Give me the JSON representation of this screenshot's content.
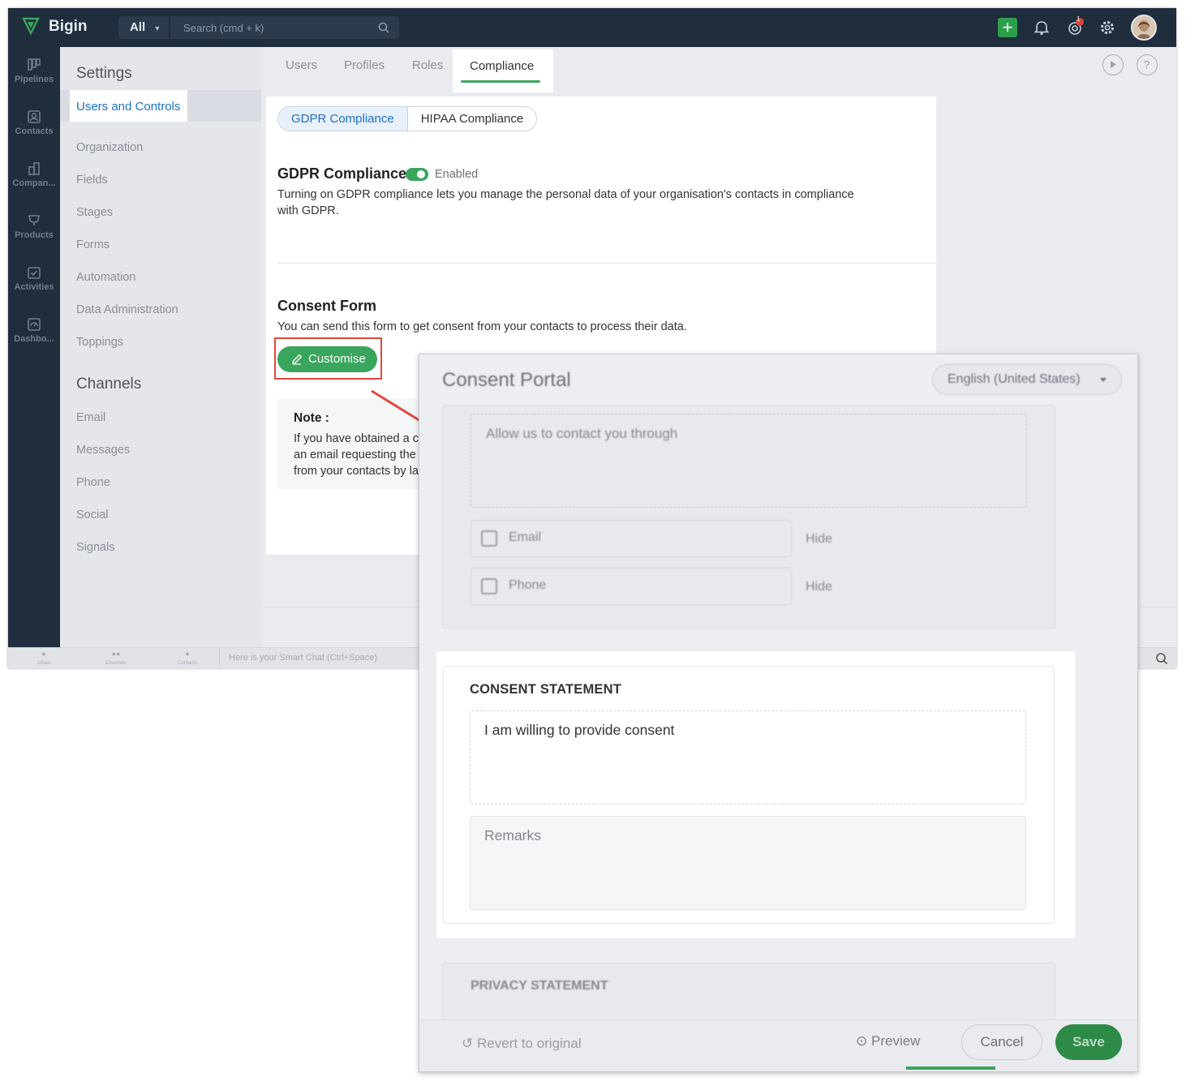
{
  "topbar": {
    "brand": "Bigin",
    "all_label": "All",
    "search_placeholder": "Search (cmd + k)",
    "notification_count": "1"
  },
  "rail": {
    "items": [
      {
        "label": "Pipelines",
        "icon": "pipelines-icon"
      },
      {
        "label": "Contacts",
        "icon": "contacts-icon"
      },
      {
        "label": "Compan...",
        "icon": "companies-icon"
      },
      {
        "label": "Products",
        "icon": "products-icon"
      },
      {
        "label": "Activities",
        "icon": "activities-icon"
      },
      {
        "label": "Dashbo...",
        "icon": "dashboards-icon"
      }
    ]
  },
  "sidebar": {
    "title": "Settings",
    "items": [
      "Users and Controls",
      "Organization",
      "Fields",
      "Stages",
      "Forms",
      "Automation",
      "Data Administration",
      "Toppings"
    ],
    "channels_title": "Channels",
    "channels": [
      "Email",
      "Messages",
      "Phone",
      "Social",
      "Signals"
    ]
  },
  "tabs": [
    "Users",
    "Profiles",
    "Roles",
    "Compliance"
  ],
  "panel": {
    "segments": [
      "GDPR Compliance",
      "HIPAA Compliance"
    ],
    "gdpr_title": "GDPR Compliance",
    "gdpr_status": "Enabled",
    "gdpr_desc_1": "Turning on GDPR compliance lets you manage the personal data of your organisation's contacts in compliance",
    "gdpr_desc_2": "with GDPR.",
    "consent_title": "Consent Form",
    "consent_desc": "You can send this form to get consent from your contacts to process their data.",
    "customise_label": "Customise",
    "note_title": "Note :",
    "note_line_1": "If you have obtained a c",
    "note_line_2": "an email requesting the",
    "note_line_3": "from your contacts by la"
  },
  "bottombar": {
    "chat_placeholder": "Here is your Smart Chat (Ctrl+Space)",
    "items": [
      "Chats",
      "Channels",
      "Contacts"
    ]
  },
  "modal": {
    "title": "Consent Portal",
    "language": "English (United States)",
    "contact_through": "Allow us to contact you through",
    "options": [
      {
        "label": "Email",
        "action": "Hide"
      },
      {
        "label": "Phone",
        "action": "Hide"
      }
    ],
    "consent_statement_title": "CONSENT STATEMENT",
    "consent_statement_text": "I am willing to provide consent",
    "remarks_placeholder": "Remarks",
    "privacy_statement_title": "PRIVACY STATEMENT",
    "revert_label": "Revert to original",
    "preview_label": "Preview",
    "cancel_label": "Cancel",
    "save_label": "Save"
  },
  "colors": {
    "accent_green": "#3aa55c",
    "link_blue": "#1f6fc5",
    "highlight_red": "#e0483e",
    "nav_dark": "#1f2d3d"
  }
}
